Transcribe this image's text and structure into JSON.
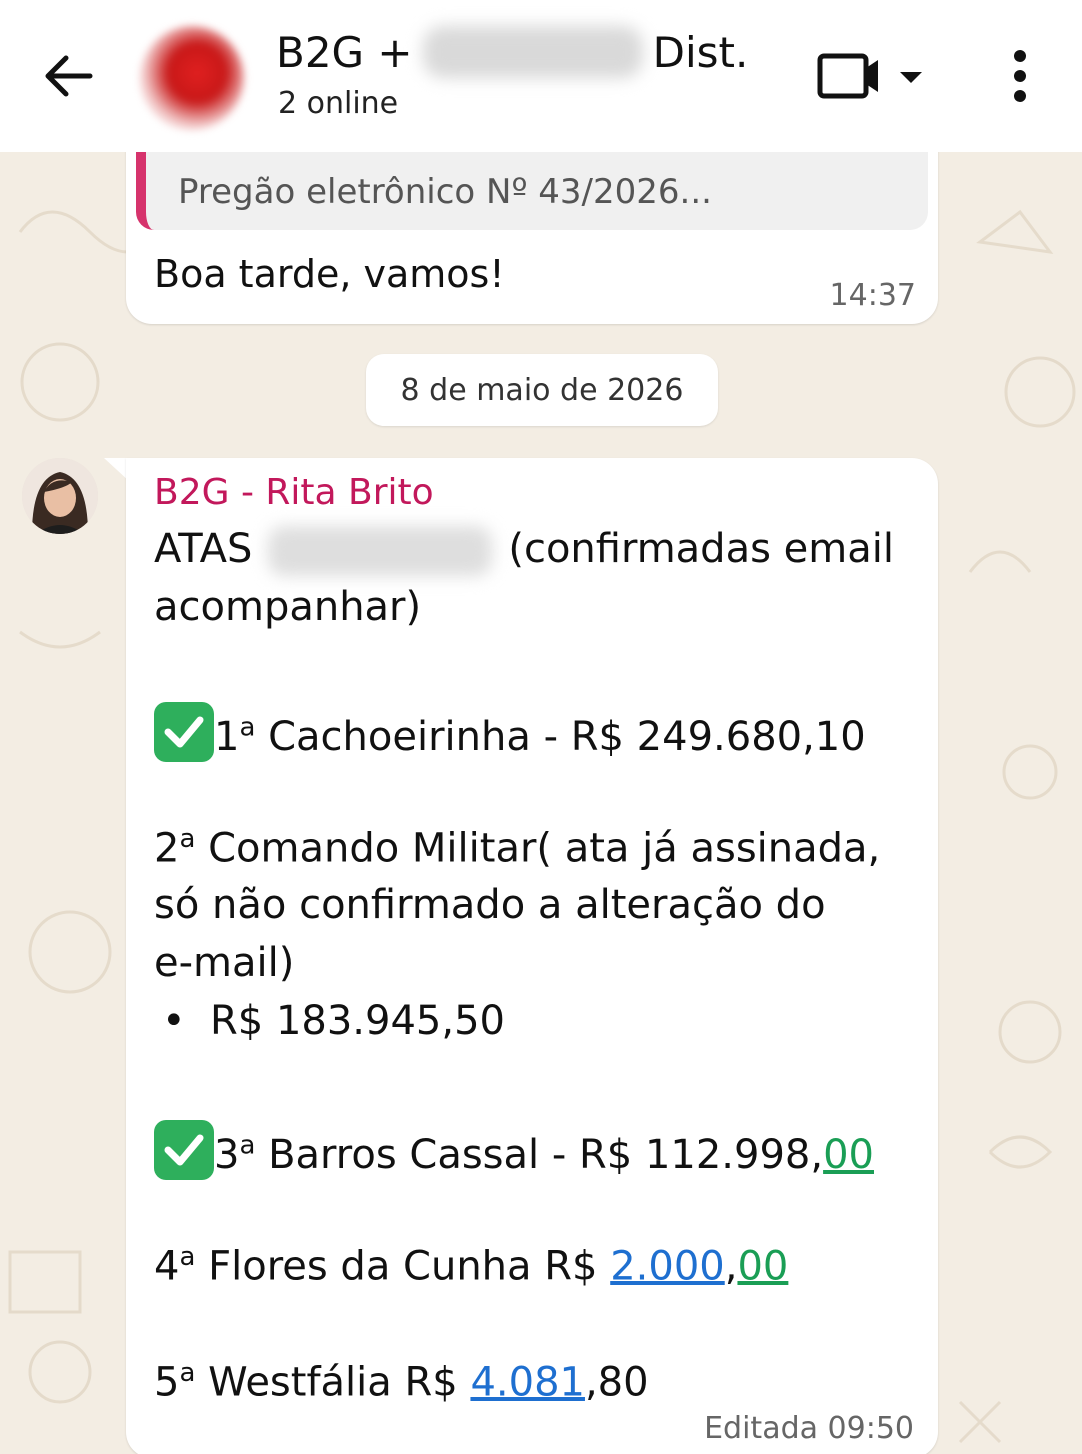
{
  "header": {
    "title_prefix": "B2G +",
    "title_suffix": "Dist.",
    "subtitle": "2 online"
  },
  "messages": [
    {
      "quote": "Pregão eletrônico Nº 43/2026...",
      "text": "Boa tarde, vamos!",
      "time": "14:37"
    }
  ],
  "date_chip": "8 de maio de 2026",
  "message2": {
    "sender": "B2G - Rita Brito",
    "line1_a": "ATAS",
    "line1_b": "(confirmadas email",
    "line2": "acompanhar)",
    "item1_num": "1",
    "item1_sup": "a",
    "item1_text": " Cachoeirinha - R$ 249.680,10",
    "item2_num": "2",
    "item2_sup": "a",
    "item2_text": " Comando Militar( ata já assinada,",
    "item2_line2": "só não confirmado a alteração do",
    "item2_line3": "e-mail)",
    "item2_bullet": "•",
    "item2_value": "R$ 183.945,50",
    "item3_num": "3",
    "item3_sup": "a",
    "item3_text": " Barros Cassal - R$ 112.998,",
    "item3_cents": "00",
    "item4_num": "4",
    "item4_sup": "a",
    "item4_text": " Flores da Cunha R$ ",
    "item4_int": "2.000",
    "item4_sep": ",",
    "item4_cents": "00",
    "item5_num": "5",
    "item5_sup": "a",
    "item5_text": " Westfália R$ ",
    "item5_int": "4.081",
    "item5_cents": ",80",
    "edited": "Editada 09:50"
  }
}
